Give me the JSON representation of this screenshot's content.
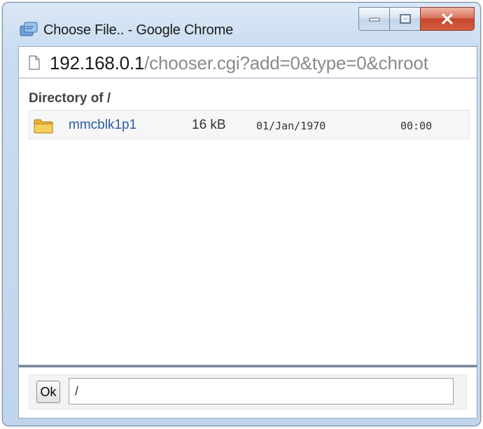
{
  "window": {
    "title": "Choose File.. - Google Chrome",
    "controls": {
      "minimize": "minimize",
      "maximize": "maximize",
      "close": "close"
    }
  },
  "address_bar": {
    "host": "192.168.0.1",
    "path": "/chooser.cgi?add=0&type=0&chroot"
  },
  "directory": {
    "heading": "Directory of /",
    "entries": [
      {
        "icon": "folder-icon",
        "name": "mmcblk1p1",
        "size": "16 kB",
        "date": "01/Jan/1970",
        "time": "00:00"
      }
    ]
  },
  "footer": {
    "ok_label": "Ok",
    "path_value": "/"
  },
  "colors": {
    "link": "#2b5aa8",
    "close_button": "#c7452b",
    "frame": "#c0d5ec"
  }
}
